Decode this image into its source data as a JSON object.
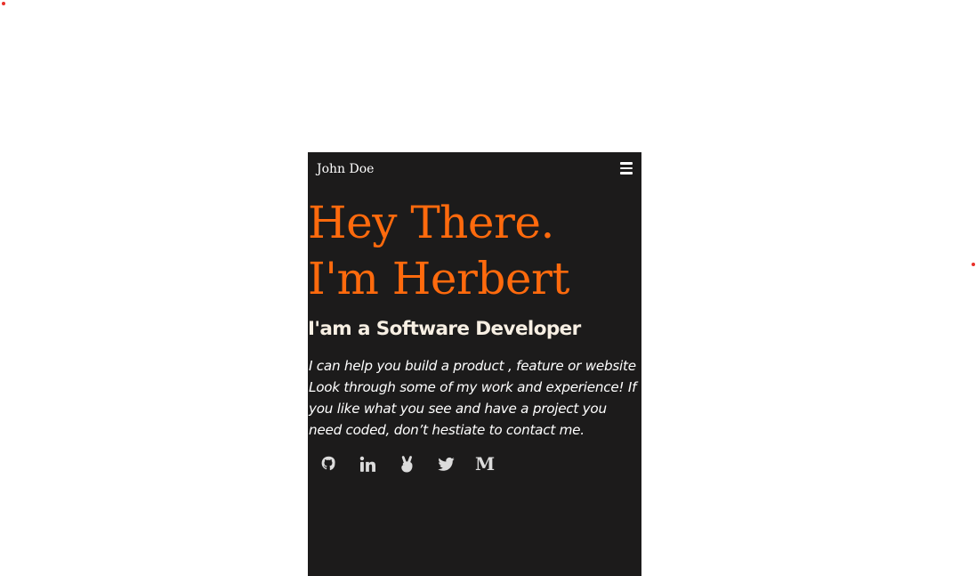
{
  "nav": {
    "brand": "John Doe",
    "menu_icon": "hamburger-menu-icon"
  },
  "hero": {
    "title_line1": "Hey There.",
    "title_line2": "I'm Herbert",
    "subtitle": "I'am a Software Developer",
    "intro": "I can help you build a product , feature or website Look through some of my work and experience! If you like what you see and have a project you need coded, don’t hestiate to contact me."
  },
  "socials": [
    {
      "name": "github",
      "icon": "github-icon"
    },
    {
      "name": "linkedin",
      "icon": "linkedin-icon"
    },
    {
      "name": "angellist",
      "icon": "angellist-icon"
    },
    {
      "name": "twitter",
      "icon": "twitter-icon"
    },
    {
      "name": "medium",
      "icon": "medium-icon",
      "glyph": "M"
    }
  ],
  "colors": {
    "background": "#1c1b1b",
    "accent": "#ff6a0d",
    "subtitle": "#f7efe3",
    "text": "#ffffff",
    "icon": "#dcdcdc"
  }
}
